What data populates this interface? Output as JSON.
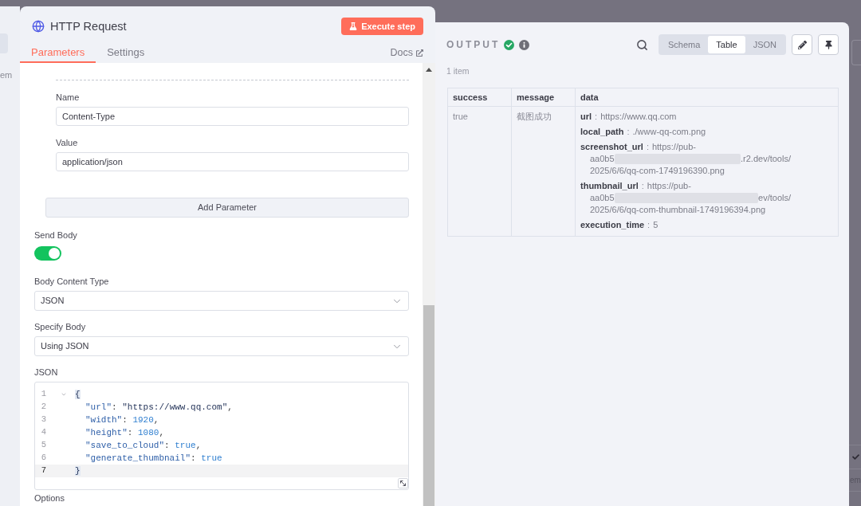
{
  "input_panel_edge": {
    "text": "em"
  },
  "node": {
    "title": "HTTP Request",
    "execute_button": "Execute step",
    "tabs": [
      {
        "label": "Parameters",
        "selected": true
      },
      {
        "label": "Settings",
        "selected": false
      }
    ],
    "docs_link": "Docs"
  },
  "header_parameter": {
    "fields": [
      {
        "label": "Name",
        "value": "Content-Type"
      },
      {
        "label": "Value",
        "value": "application/json"
      }
    ],
    "add_button": "Add Parameter"
  },
  "send_body": {
    "label": "Send Body",
    "on": true
  },
  "selects": [
    {
      "label": "Body Content Type",
      "value": "JSON"
    },
    {
      "label": "Specify Body",
      "value": "Using JSON"
    }
  ],
  "json_editor": {
    "label": "JSON",
    "lines": [
      {
        "number": "1",
        "foldable": true,
        "indented": false,
        "active": false,
        "tokens": [
          {
            "kind": "bracket",
            "text": "{"
          }
        ]
      },
      {
        "number": "2",
        "foldable": false,
        "indented": true,
        "active": false,
        "tokens": [
          {
            "kind": "key",
            "text": "\"url\""
          },
          {
            "kind": "punct",
            "text": ": "
          },
          {
            "kind": "string",
            "text": "\"https://www.qq.com\""
          },
          {
            "kind": "punct",
            "text": ","
          }
        ]
      },
      {
        "number": "3",
        "foldable": false,
        "indented": true,
        "active": false,
        "tokens": [
          {
            "kind": "key",
            "text": "\"width\""
          },
          {
            "kind": "punct",
            "text": ": "
          },
          {
            "kind": "number",
            "text": "1920"
          },
          {
            "kind": "punct",
            "text": ","
          }
        ]
      },
      {
        "number": "4",
        "foldable": false,
        "indented": true,
        "active": false,
        "tokens": [
          {
            "kind": "key",
            "text": "\"height\""
          },
          {
            "kind": "punct",
            "text": ": "
          },
          {
            "kind": "number",
            "text": "1080"
          },
          {
            "kind": "punct",
            "text": ","
          }
        ]
      },
      {
        "number": "5",
        "foldable": false,
        "indented": true,
        "active": false,
        "tokens": [
          {
            "kind": "key",
            "text": "\"save_to_cloud\""
          },
          {
            "kind": "punct",
            "text": ": "
          },
          {
            "kind": "boolean",
            "text": "true"
          },
          {
            "kind": "punct",
            "text": ","
          }
        ]
      },
      {
        "number": "6",
        "foldable": false,
        "indented": true,
        "active": false,
        "tokens": [
          {
            "kind": "key",
            "text": "\"generate_thumbnail\""
          },
          {
            "kind": "punct",
            "text": ": "
          },
          {
            "kind": "boolean",
            "text": "true"
          }
        ]
      },
      {
        "number": "7",
        "foldable": false,
        "indented": false,
        "active": true,
        "tokens": [
          {
            "kind": "bracket",
            "text": "}"
          }
        ]
      }
    ]
  },
  "next_section_label": "Options",
  "output": {
    "title": "OUTPUT",
    "view_tabs": [
      {
        "label": "Schema",
        "selected": false
      },
      {
        "label": "Table",
        "selected": true
      },
      {
        "label": "JSON",
        "selected": false
      }
    ],
    "item_count": "1 item",
    "table": {
      "columns": [
        "success",
        "message",
        "data"
      ],
      "rows": [
        {
          "success": "true",
          "message": "截图成功",
          "data": [
            {
              "key": "url",
              "separator": ":",
              "value": "https://www.qq.com"
            },
            {
              "key": "local_path",
              "separator": ":",
              "value": "./www-qq-com.png"
            },
            {
              "key": "screenshot_url",
              "separator": ":",
              "value": "https://pub-",
              "wrapped_lines": [
                {
                  "segments": [
                    {
                      "kind": "text",
                      "text": "aa0b5"
                    },
                    {
                      "kind": "redacted"
                    },
                    {
                      "kind": "text",
                      "text": ".r2.dev/tools/"
                    }
                  ]
                },
                {
                  "segments": [
                    {
                      "kind": "text",
                      "text": "2025/6/6/qq-com-1749196390.png"
                    }
                  ]
                }
              ]
            },
            {
              "key": "thumbnail_url",
              "separator": ":",
              "value": "https://pub-",
              "wrapped_lines": [
                {
                  "segments": [
                    {
                      "kind": "text",
                      "text": "aa0b5"
                    },
                    {
                      "kind": "redacted"
                    },
                    {
                      "kind": "text",
                      "text": "ev/tools/"
                    }
                  ]
                },
                {
                  "segments": [
                    {
                      "kind": "text",
                      "text": "2025/6/6/qq-com-thumbnail-1749196394.png"
                    }
                  ]
                }
              ]
            },
            {
              "key": "execution_time",
              "separator": ":",
              "value": "5"
            }
          ]
        }
      ]
    }
  },
  "canvas_edge": {
    "text": "em"
  }
}
